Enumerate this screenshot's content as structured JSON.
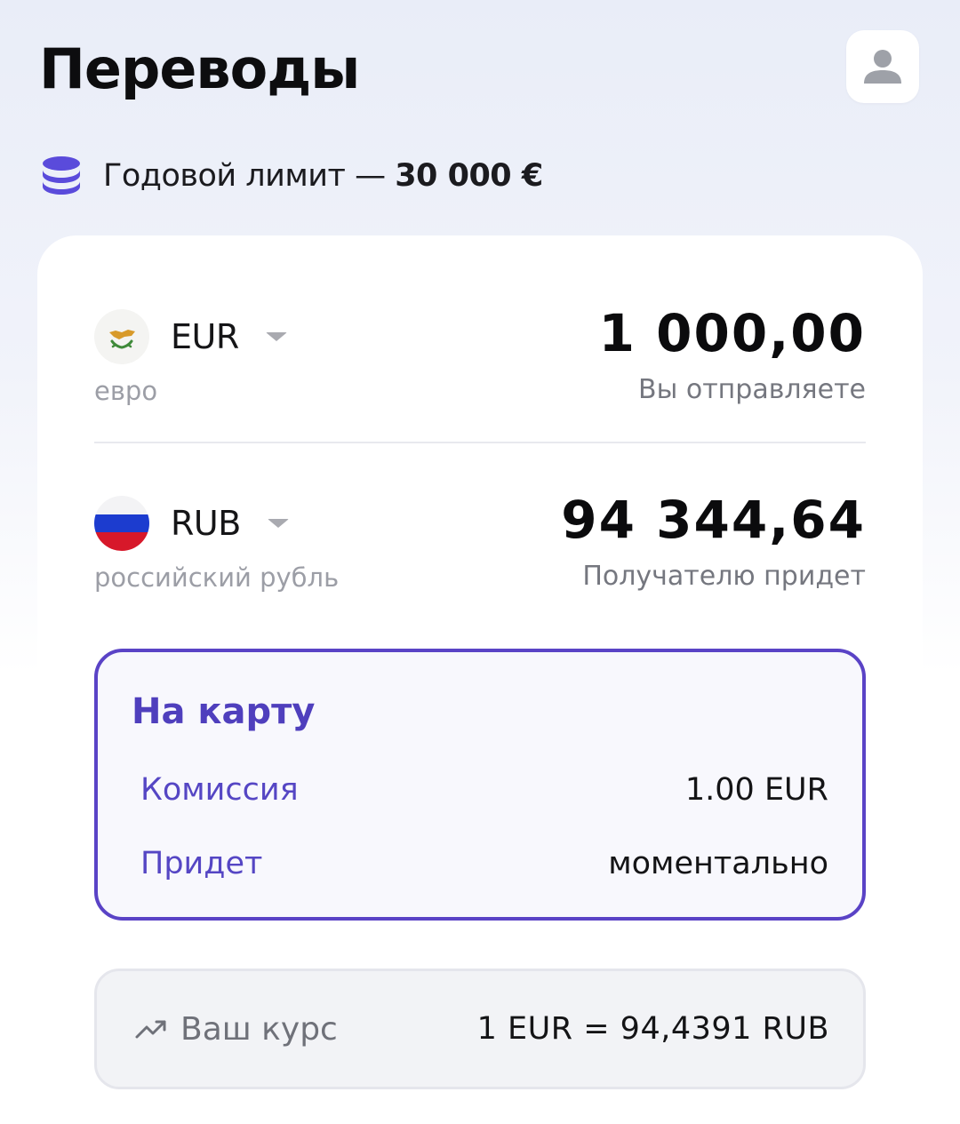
{
  "header": {
    "title": "Переводы",
    "profile_icon": "user-icon"
  },
  "limit": {
    "icon": "coins-stack-icon",
    "label": "Годовой лимит — ",
    "value": "30 000 €",
    "accent_color": "#5a4bdb"
  },
  "send": {
    "currency_code": "EUR",
    "currency_name": "евро",
    "flag": "cyprus-flag-icon",
    "amount": "1 000,00",
    "caption": "Вы отправляете"
  },
  "receive": {
    "currency_code": "RUB",
    "currency_name": "российский рубль",
    "flag": "russia-flag-icon",
    "amount": "94 344,64",
    "caption": "Получателю придет"
  },
  "method": {
    "title": "На карту",
    "fee_label": "Комиссия",
    "fee_value": "1.00 EUR",
    "time_label": "Придет",
    "time_value": "моментально",
    "border_color": "#5a43c6"
  },
  "rate": {
    "icon": "trending-up-icon",
    "label": "Ваш курс",
    "value": "1 EUR = 94,4391  RUB"
  }
}
